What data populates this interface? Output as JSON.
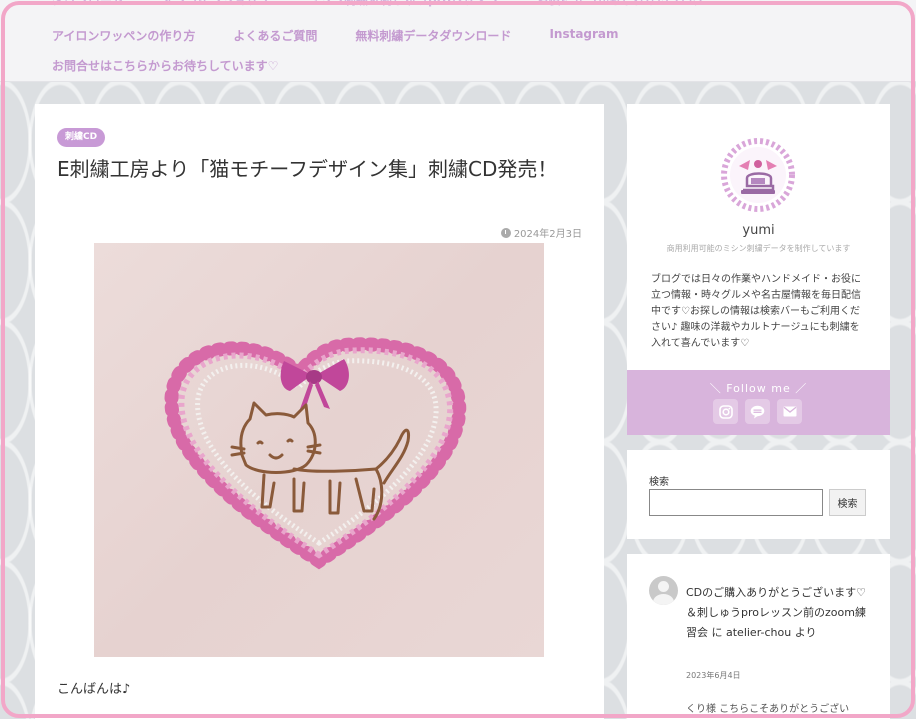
{
  "nav": {
    "row0": [
      "ダウンロード",
      "オンラインショップ",
      "ミシン刺繍＆刺しゅうproレッスン",
      "お役に立つかもしれないブログ"
    ],
    "row1": [
      "アイロンワッペンの作り方",
      "よくあるご質問",
      "無料刺繍データダウンロード",
      "Instagram"
    ],
    "row2": [
      "お問合せはこちらからお待ちしています♡"
    ]
  },
  "post": {
    "category": "刺繍CD",
    "title": "E刺繍工房より「猫モチーフデザイン集」刺繍CD発売！",
    "date": "2024年2月3日",
    "greeting": "こんばんは♪"
  },
  "profile": {
    "name": "yumi",
    "tagline": "商用利用可能のミシン刺繍データを制作しています",
    "bio": "ブログでは日々の作業やハンドメイド・お役に立つ情報・時々グルメや名古屋情報を毎日配信中です♡お探しの情報は検索バーもご利用ください♪ 趣味の洋裁やカルトナージュにも刺繍を入れて喜んでいます♡",
    "follow_label": "＼ Follow me ／",
    "sns_icons": [
      "instagram-icon",
      "line-icon",
      "mail-icon"
    ]
  },
  "search": {
    "label": "検索",
    "placeholder": "",
    "button": "検索"
  },
  "comment": {
    "text": "CDのご購入ありがとうございます♡＆刺しゅうproレッスン前のzoom練習会 に atelier-chou より",
    "date": "2023年6月4日",
    "snippet": "くり様 こちらこそありがとうござい"
  },
  "colors": {
    "accent": "#c89ad6",
    "follow_band": "#d8b4dc",
    "frame": "#f2a7c8",
    "nav_text": "#c49ad0"
  }
}
